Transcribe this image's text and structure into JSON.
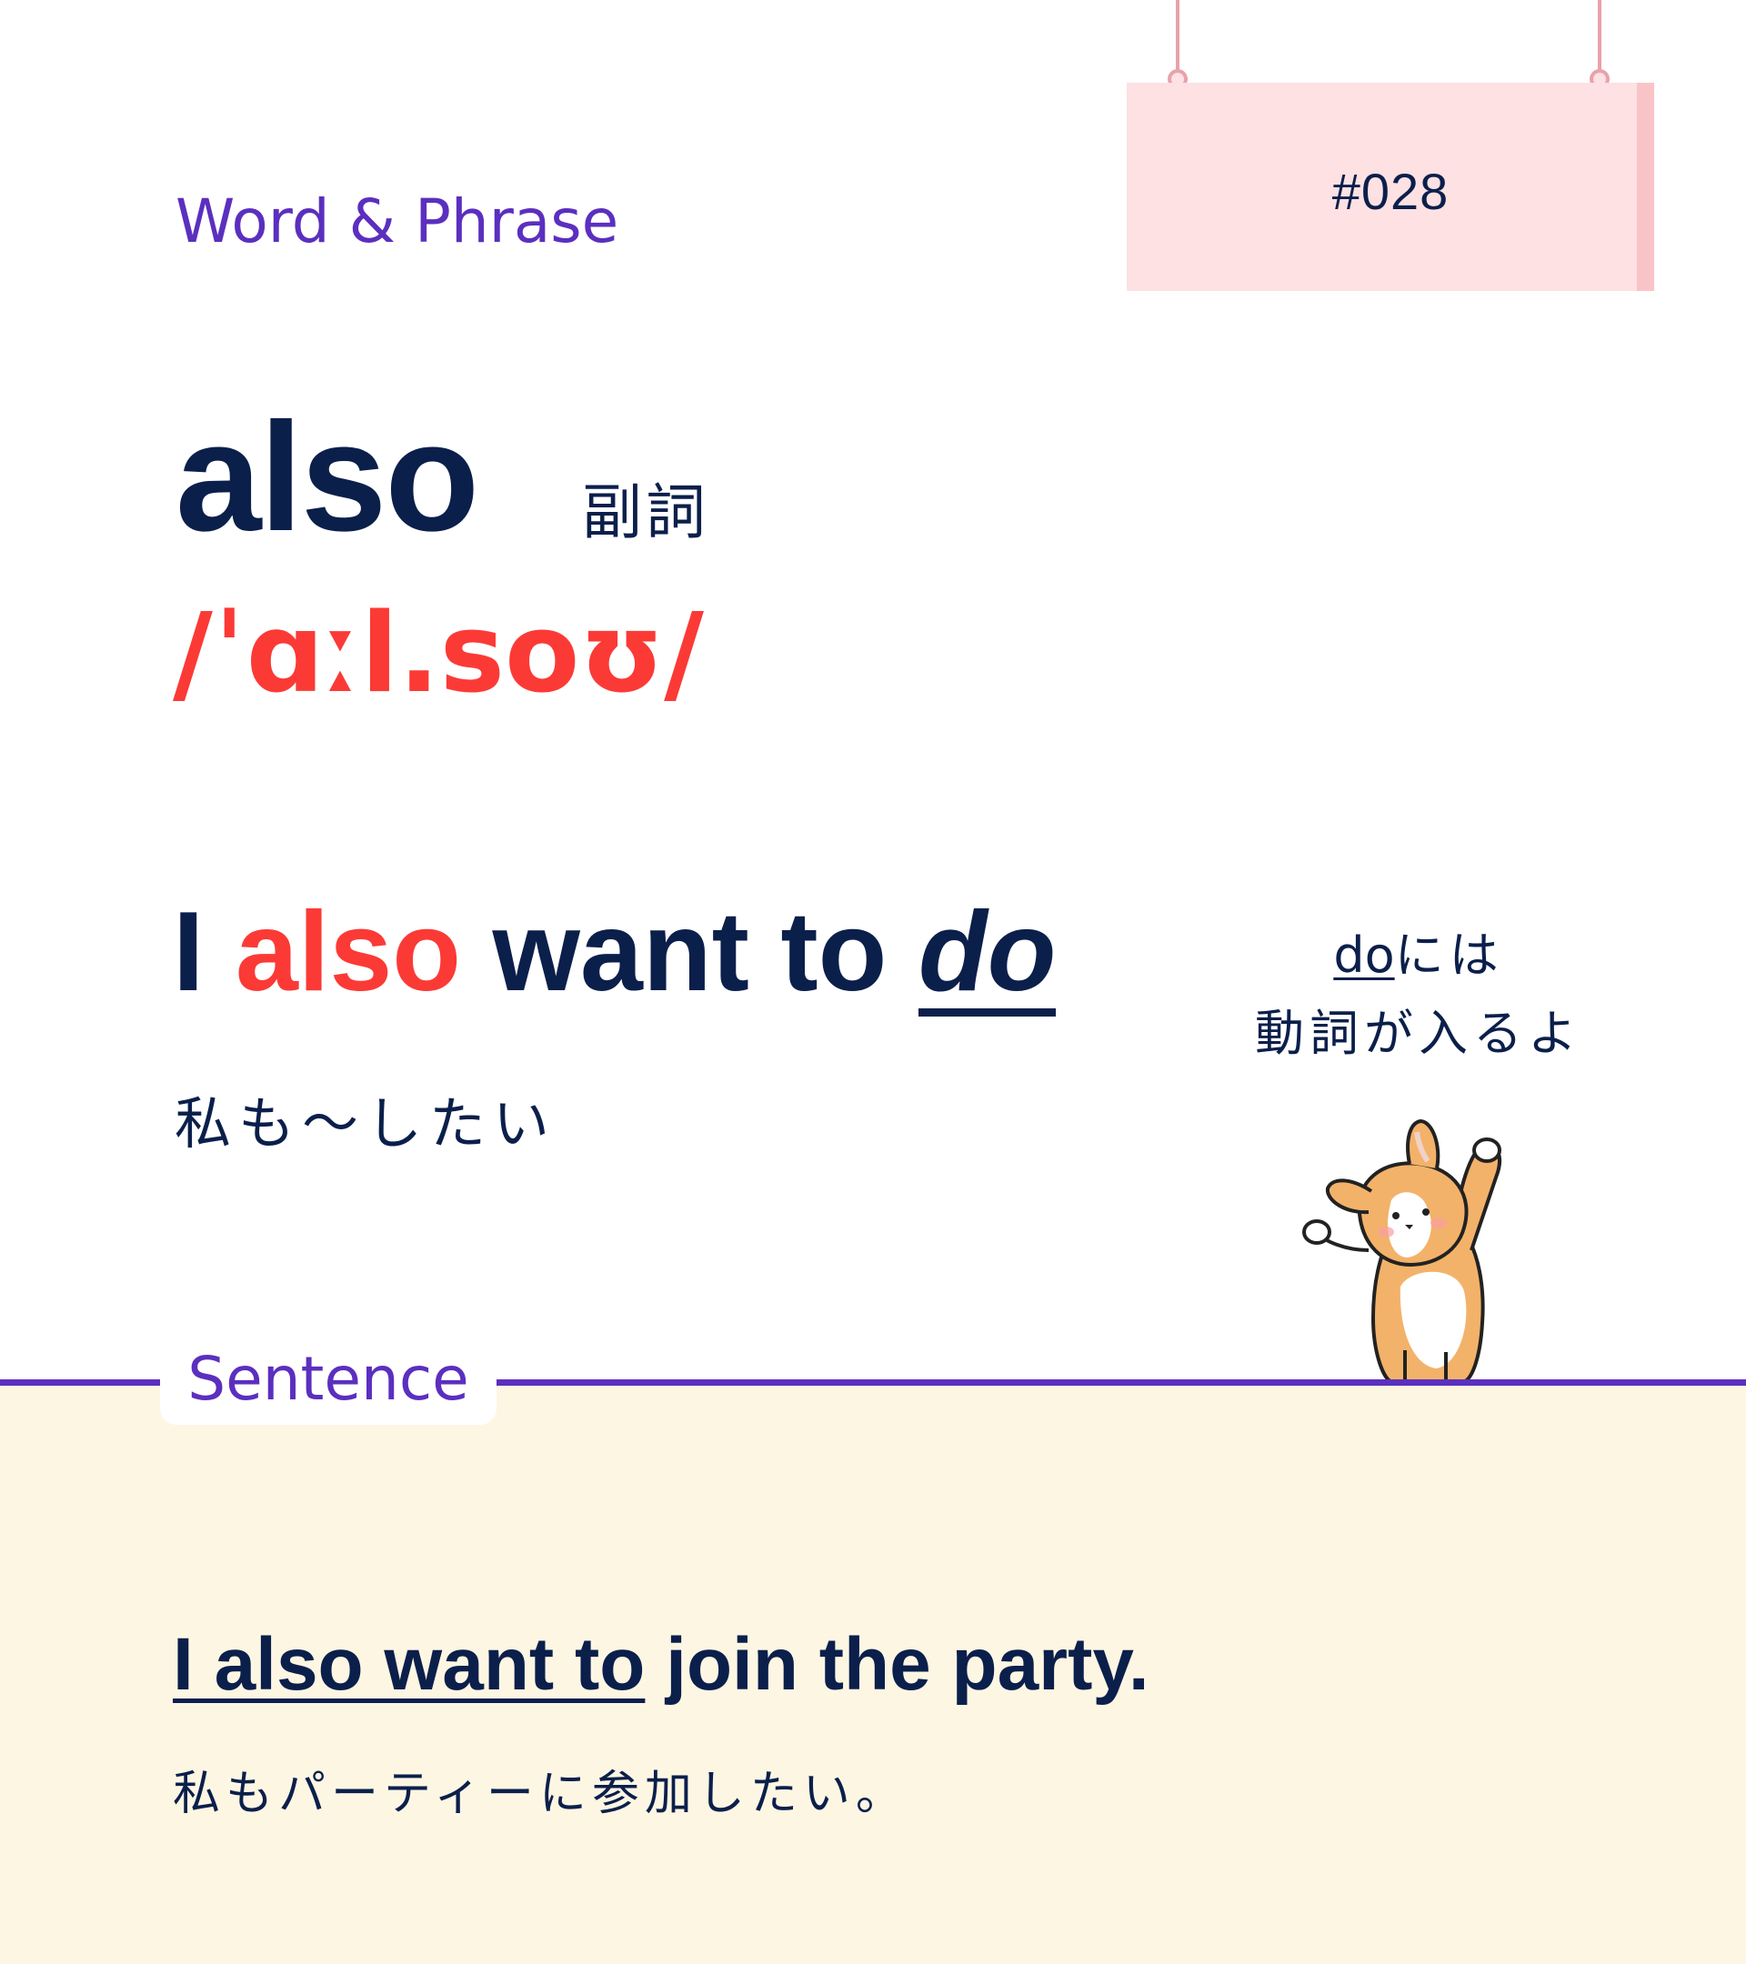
{
  "header": {
    "section_label": "Word & Phrase",
    "sign_number": "#028"
  },
  "word": {
    "text": "also",
    "part_of_speech": "副詞",
    "ipa": "/ˈɑːl.soʊ/"
  },
  "pattern": {
    "part1": "I ",
    "highlight": "also",
    "part2": " want to ",
    "slot": "do",
    "translation": "私も～したい"
  },
  "note": {
    "underlined": "do",
    "line1_rest": "には",
    "line2": "動詞が入るよ"
  },
  "sentence_section": {
    "label": "Sentence",
    "sentence_underlined": "I also want to",
    "sentence_rest": " join the party.",
    "translation": "私もパーティーに参加したい。"
  },
  "colors": {
    "accent_purple": "#5b2fbf",
    "highlight_red": "#fb3a36",
    "text_navy": "#0b1f4b",
    "sign_pink": "#fde1e3",
    "panel_cream": "#fdf6e3"
  },
  "icons": {
    "mascot": "corgi-mascot"
  }
}
